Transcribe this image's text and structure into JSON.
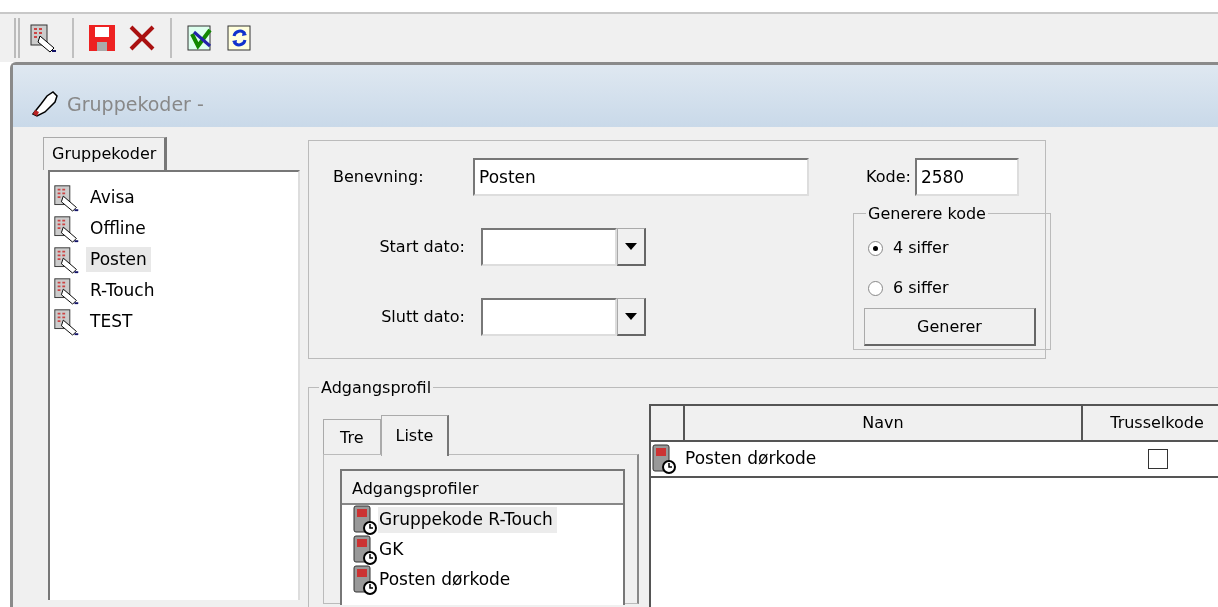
{
  "toolbar": {
    "groups": [
      [
        {
          "kind": "keypad"
        }
      ],
      [
        {
          "kind": "save"
        },
        {
          "kind": "delete"
        }
      ],
      [
        {
          "kind": "export"
        },
        {
          "kind": "refresh"
        }
      ]
    ]
  },
  "window": {
    "title": "Gruppekoder -"
  },
  "left_tabs": [
    {
      "label": "Gruppekoder",
      "selected": true
    }
  ],
  "group_list": [
    {
      "label": "Avisa",
      "selected": false
    },
    {
      "label": "Offline",
      "selected": false
    },
    {
      "label": "Posten",
      "selected": true
    },
    {
      "label": "R-Touch",
      "selected": false
    },
    {
      "label": "TEST",
      "selected": false
    }
  ],
  "form": {
    "name_label": "Benevning:",
    "name_value": "Posten",
    "code_label": "Kode:",
    "code_value": "2580",
    "start_label": "Start dato:",
    "end_label": "Slutt dato:",
    "generate": {
      "title": "Generere kode",
      "options": [
        {
          "label": "4 siffer",
          "selected": true
        },
        {
          "label": "6 siffer",
          "selected": false
        }
      ],
      "button": "Generer"
    }
  },
  "access_profile": {
    "title": "Adgangsprofil",
    "tabs": [
      {
        "label": "Tre",
        "selected": false
      },
      {
        "label": "Liste",
        "selected": true
      }
    ],
    "list_header": "Adgangsprofiler",
    "items": [
      {
        "label": "Gruppekode R-Touch",
        "selected": true
      },
      {
        "label": "GK",
        "selected": false
      },
      {
        "label": "Posten dørkode",
        "selected": false
      }
    ],
    "grid": {
      "columns": [
        "Navn",
        "Trusselkode"
      ],
      "rows": [
        {
          "name": "Posten dørkode",
          "threat": false
        }
      ]
    }
  }
}
